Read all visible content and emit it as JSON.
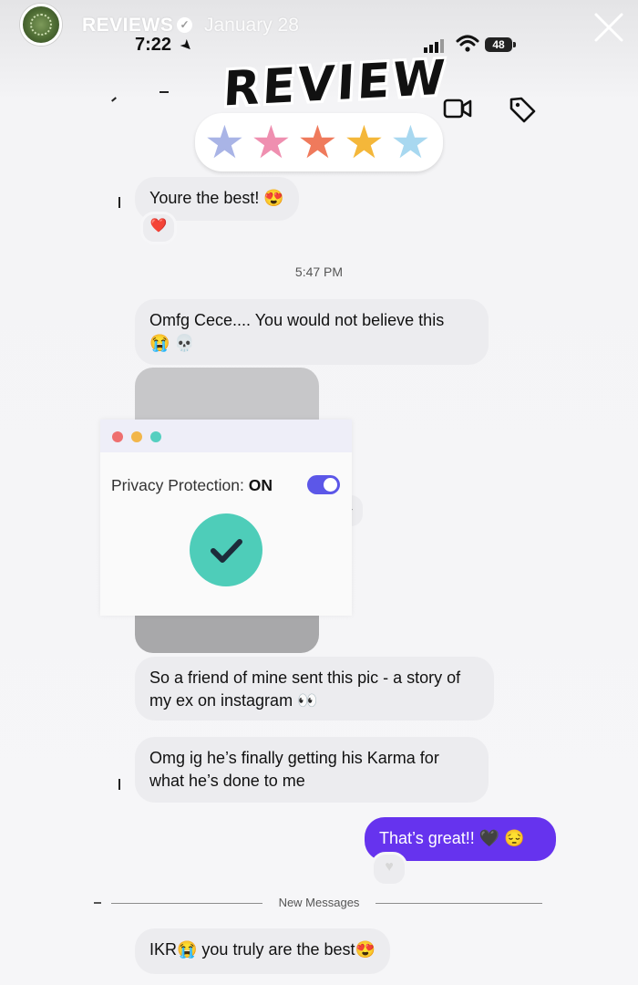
{
  "story": {
    "account_name": "REVIEWS",
    "date": "January 28",
    "close_icon": "close-icon",
    "verified_icon": "verified-badge-icon"
  },
  "status_bar": {
    "time": "7:22",
    "battery": "48"
  },
  "header": {
    "sticker_text": "REVIEW",
    "star_rating": 5,
    "star_colors": [
      "#a9b4e6",
      "#ef8fb0",
      "#ef7a5c",
      "#f4b73a",
      "#a8d8f0"
    ],
    "video_icon": "video-call-icon",
    "tag_icon": "tag-icon"
  },
  "messages": [
    {
      "text": "Youre the best! 😍",
      "reaction": "❤️"
    },
    {
      "timestamp": "5:47 PM"
    },
    {
      "text": "Omfg Cece.... You would not believe this",
      "emoji_line": "😭 💀"
    },
    {
      "text": "So a friend of mine sent this pic - a story of my ex on instagram 👀"
    },
    {
      "text": "Omg ig he’s finally getting his Karma for what he’s done to me"
    },
    {
      "text": "That’s great!! 🖤 😔",
      "reaction": "♥"
    },
    {
      "divider": "New Messages"
    },
    {
      "text": "IKR😭  you truly are the best😍"
    }
  ],
  "privacy_sticker": {
    "label": "Privacy Protection:",
    "state": "ON",
    "toggle_on": true,
    "dot_colors": [
      "#ee6f6f",
      "#f2b64a",
      "#55cfc0"
    ],
    "check_color": "#4ecdb9",
    "accent": "#5c57e8"
  },
  "colors": {
    "sent_bubble": "#6633ee",
    "received_bubble": "#ececef"
  }
}
